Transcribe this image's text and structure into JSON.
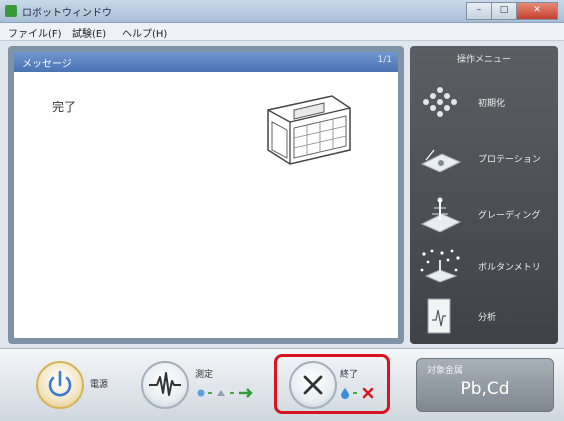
{
  "window": {
    "title": "ロボットウィンドウ"
  },
  "menu": {
    "items": [
      "ファイル(F)",
      "試験(E)",
      "ヘルプ(H)"
    ]
  },
  "message_panel": {
    "title": "メッセージ",
    "count": "1/1",
    "status": "完了"
  },
  "sidebar": {
    "header": "操作メニュー",
    "items": [
      {
        "label": "初期化",
        "icon": "dot-grid-icon"
      },
      {
        "label": "プロテーション",
        "icon": "plate-icon"
      },
      {
        "label": "グレーディング",
        "icon": "spray-icon"
      },
      {
        "label": "ボルタンメトリ",
        "icon": "sparkle-icon"
      },
      {
        "label": "分析",
        "icon": "document-icon"
      }
    ]
  },
  "bottom_bar": {
    "power_label": "電源",
    "measure_label": "測定",
    "exit_label": "終了",
    "sample": {
      "label": "対象金属",
      "value": "Pb,Cd"
    }
  },
  "colors": {
    "highlight": "#d8141e",
    "accent": "#4b73b2"
  }
}
